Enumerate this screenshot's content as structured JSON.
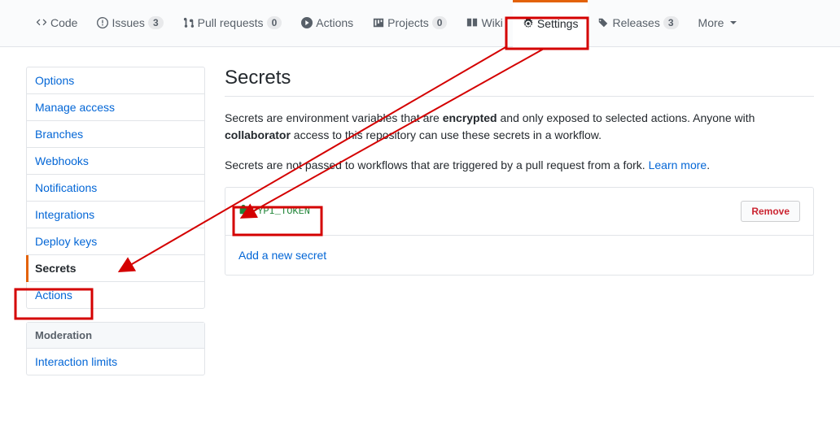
{
  "tabs": {
    "code": "Code",
    "issues": "Issues",
    "issues_count": "3",
    "pulls": "Pull requests",
    "pulls_count": "0",
    "actions": "Actions",
    "projects": "Projects",
    "projects_count": "0",
    "wiki": "Wiki",
    "settings": "Settings",
    "releases": "Releases",
    "releases_count": "3",
    "more": "More"
  },
  "sidebar": {
    "items": [
      {
        "label": "Options"
      },
      {
        "label": "Manage access"
      },
      {
        "label": "Branches"
      },
      {
        "label": "Webhooks"
      },
      {
        "label": "Notifications"
      },
      {
        "label": "Integrations"
      },
      {
        "label": "Deploy keys"
      },
      {
        "label": "Secrets"
      },
      {
        "label": "Actions"
      }
    ],
    "moderation_heading": "Moderation",
    "moderation_item": "Interaction limits"
  },
  "main": {
    "title": "Secrets",
    "intro1_a": "Secrets are environment variables that are ",
    "intro1_b": "encrypted",
    "intro1_c": " and only exposed to selected actions. Anyone with ",
    "intro1_d": "collaborator",
    "intro1_e": " access to this repository can use these secrets in a workflow.",
    "intro2_a": "Secrets are not passed to workflows that are triggered by a pull request from a fork. ",
    "learn_more": "Learn more",
    "period": ".",
    "secret_name": "PYPI_TOKEN",
    "remove": "Remove",
    "add_new": "Add a new secret"
  }
}
